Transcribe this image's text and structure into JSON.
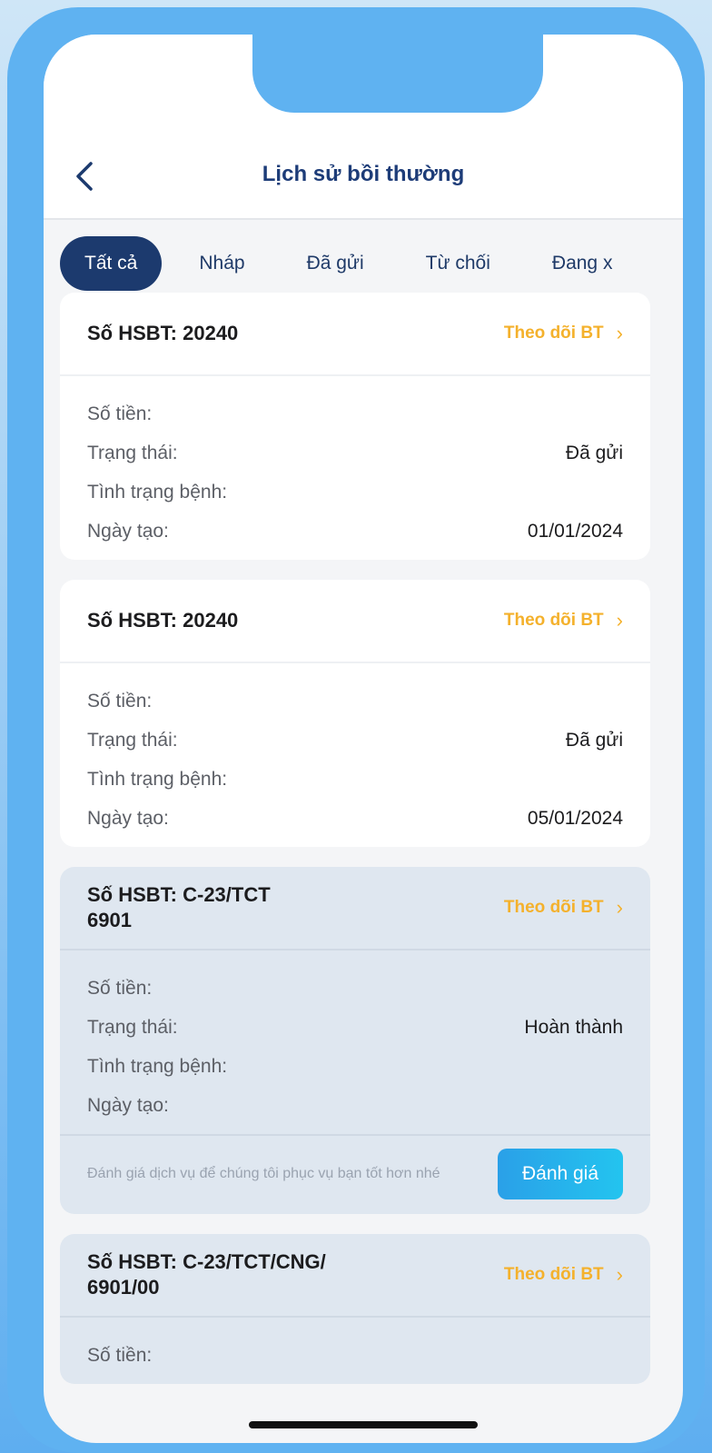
{
  "header": {
    "title": "Lịch sử bồi thường"
  },
  "tabs": [
    {
      "label": "Tất cả",
      "active": true
    },
    {
      "label": "Nháp",
      "active": false
    },
    {
      "label": "Đã gửi",
      "active": false
    },
    {
      "label": "Từ chối",
      "active": false
    },
    {
      "label": "Đang x",
      "active": false
    }
  ],
  "row_labels": {
    "amount": "Số tiền:",
    "status": "Trạng thái:",
    "condition": "Tình trạng bệnh:",
    "created": "Ngày tạo:"
  },
  "track_label": "Theo dõi BT",
  "claims": [
    {
      "id": "Số HSBT: 20240",
      "amount": "",
      "status": "Đã gửi",
      "condition": "",
      "created": "01/01/2024"
    },
    {
      "id": "Số HSBT: 20240",
      "amount": "",
      "status": "Đã gửi",
      "condition": "",
      "created": "05/01/2024"
    },
    {
      "id_line1": "Số HSBT: C-23/TCT",
      "id_line2": "6901",
      "amount": "",
      "status": "Hoàn thành",
      "condition": "",
      "created": "",
      "feedback_text": "Đánh giá dịch vụ để chúng tôi phục vụ bạn tốt hơn nhé",
      "feedback_button": "Đánh giá"
    },
    {
      "id_line1": "Số HSBT: C-23/TCT/CNG/",
      "id_line2": "6901/00",
      "amount": ""
    }
  ],
  "colors": {
    "primary": "#1c3a6e",
    "accent": "#f4b12c",
    "frame": "#5fb2f1",
    "button": "#2aa0e8"
  },
  "icons": {
    "back": "chevron-left-icon",
    "track": "chevron-right-icon"
  }
}
